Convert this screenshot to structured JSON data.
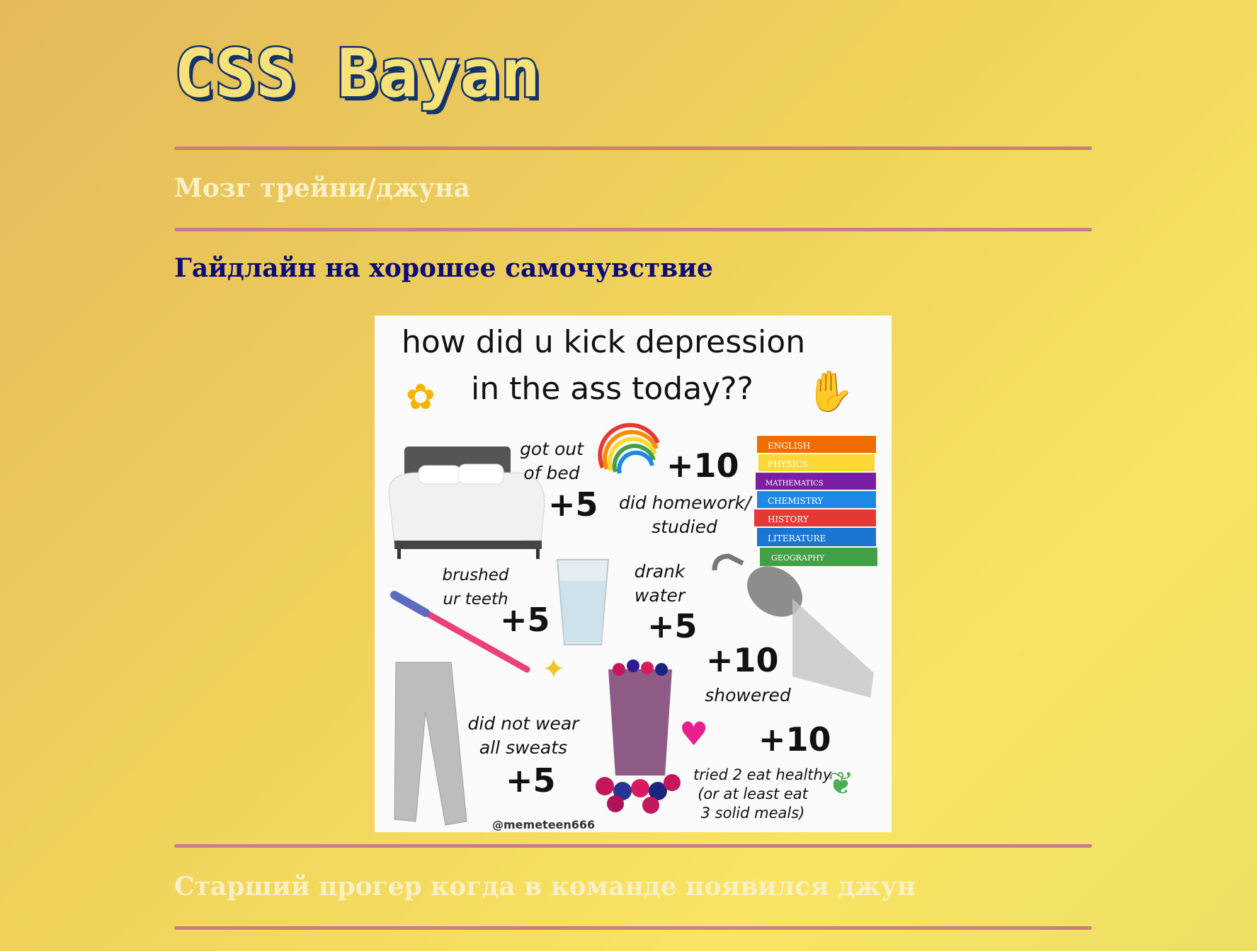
{
  "site": {
    "title": "CSS Bayan"
  },
  "posts": [
    {
      "title": "Мозг трейни/джуна"
    },
    {
      "title": "Гайдлайн на хорошее самочувствие"
    },
    {
      "title": "Старший прогер когда в команде появился джун"
    }
  ],
  "meme": {
    "headline": [
      "how did u kick depression",
      "in the ass today??"
    ],
    "items": [
      {
        "caption": [
          "got out",
          "of bed"
        ],
        "points": "+5"
      },
      {
        "caption": [
          "did homework/",
          "studied"
        ],
        "points": "+10"
      },
      {
        "caption": [
          "brushed",
          "ur teeth"
        ],
        "points": "+5"
      },
      {
        "caption": [
          "drank",
          "water"
        ],
        "points": "+5"
      },
      {
        "caption": [
          "showered"
        ],
        "points": "+10"
      },
      {
        "caption": [
          "did not wear",
          "all sweats"
        ],
        "points": "+5"
      },
      {
        "caption": [
          "tried 2 eat healthy",
          "(or at least eat",
          "3 solid meals)"
        ],
        "points": "+10"
      }
    ],
    "books": [
      "ENGLISH",
      "PHYSICS",
      "MATHEMATICS",
      "CHEMISTRY",
      "HISTORY",
      "LITERATURE",
      "GEOGRAPHY"
    ],
    "handle": "@memeteen666"
  },
  "colors": {
    "divider": "#c97e80",
    "title_fill": "#f7e27a",
    "title_outline": "#13336a",
    "link_muted": "#fbf0c4",
    "link_active": "#0b0a78"
  }
}
